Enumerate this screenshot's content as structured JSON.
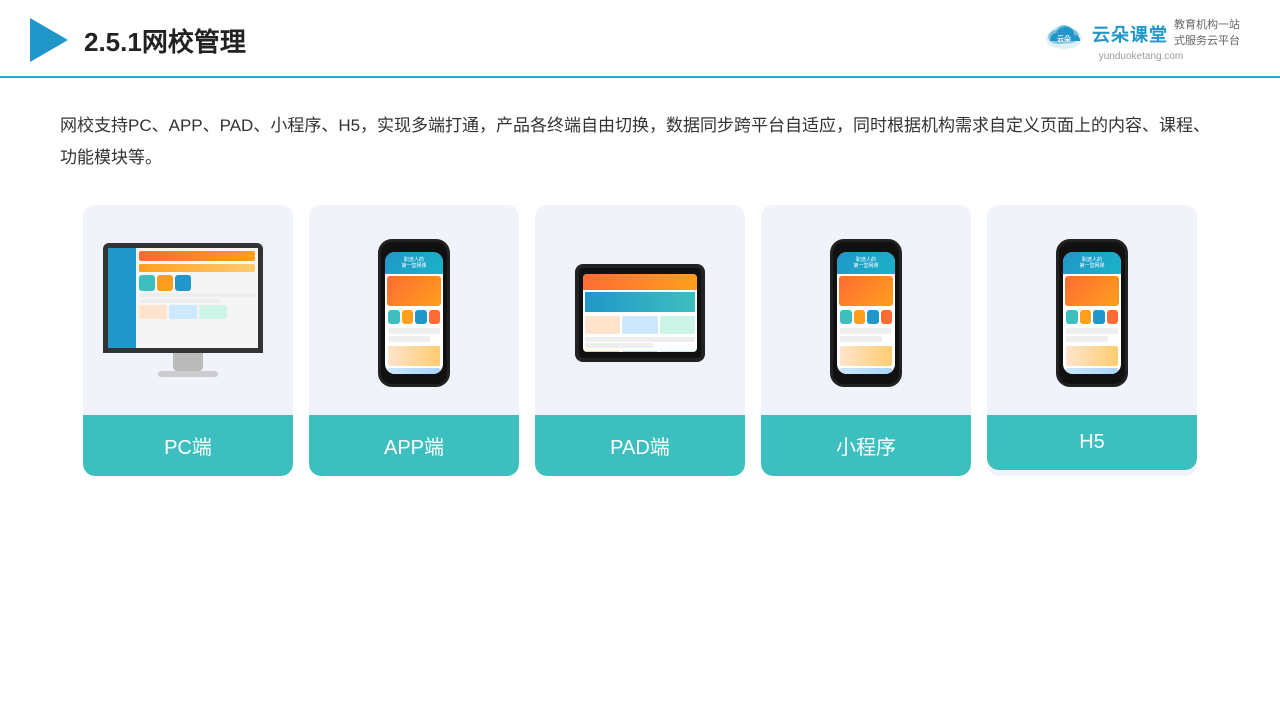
{
  "header": {
    "title": "网校管理",
    "section_num": "2.5.1",
    "border_color": "#1ab3c8"
  },
  "logo": {
    "brand": "云朵课堂",
    "url": "yunduoketang.com",
    "tagline": "教育机构一站\n式服务云平台",
    "accent_color": "#2196c8"
  },
  "description": "网校支持PC、APP、PAD、小程序、H5，实现多端打通，产品各终端自由切换，数据同步跨平台自适应，同时根据机构需求自定义页面上的内容、课程、功能模块等。",
  "cards": [
    {
      "id": "pc",
      "label": "PC端"
    },
    {
      "id": "app",
      "label": "APP端"
    },
    {
      "id": "pad",
      "label": "PAD端"
    },
    {
      "id": "mini",
      "label": "小程序"
    },
    {
      "id": "h5",
      "label": "H5"
    }
  ],
  "label_bg": "#3dbfbf"
}
